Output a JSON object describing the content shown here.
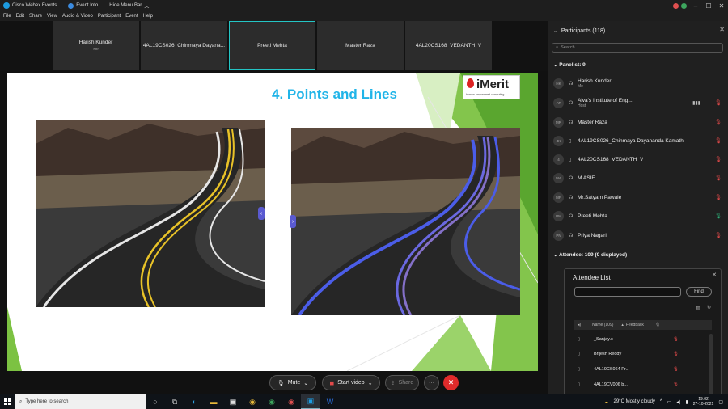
{
  "titlebar": {
    "app_name": "Cisco Webex Events",
    "event_info": "Event Info",
    "hide_menu_bar": "Hide Menu Bar",
    "avatar_colors": [
      "#e05050",
      "#3da55d"
    ]
  },
  "menu": [
    "File",
    "Edit",
    "Share",
    "View",
    "Audio & Video",
    "Participant",
    "Event",
    "Help"
  ],
  "video_tiles": [
    {
      "name": "Harish Kunder",
      "sub": "Me",
      "active": false
    },
    {
      "name": "4AL19CS026_Chinmaya Dayana...",
      "sub": "",
      "active": false
    },
    {
      "name": "Preeti Mehta",
      "sub": "",
      "active": true
    },
    {
      "name": "Master Raza",
      "sub": "",
      "active": false
    },
    {
      "name": "4AL20CS168_VEDANTH_V",
      "sub": "",
      "active": false
    }
  ],
  "slide": {
    "title": "4. Points and Lines",
    "logo_text": "iMerit",
    "logo_tagline": "human-empowered computing",
    "accent_green": "#7cc242",
    "title_color": "#20b4e8"
  },
  "controls": {
    "mute": "Mute",
    "start_video": "Start video",
    "share": "Share",
    "more": "···",
    "end": "✕"
  },
  "participants": {
    "title": "Participants (118)",
    "search_placeholder": "Search",
    "panelist_label": "Panelist: 9",
    "panelists": [
      {
        "initials": "HK",
        "name": "Harish Kunder",
        "sub": "Me",
        "mic": "none"
      },
      {
        "initials": "AT",
        "name": "Alva's Institute of Eng...",
        "sub": "Host",
        "mic": "muted",
        "level": true
      },
      {
        "initials": "MR",
        "name": "Master Raza",
        "sub": "",
        "mic": "muted"
      },
      {
        "initials": "4K",
        "name": "4AL19CS026_Chinmaya Dayananda Kamath",
        "sub": "",
        "mic": "muted",
        "device": true
      },
      {
        "initials": "4",
        "name": "4AL20CS168_VEDANTH_V",
        "sub": "",
        "mic": "muted",
        "device": true
      },
      {
        "initials": "MA",
        "name": "M ASIF",
        "sub": "",
        "mic": "muted"
      },
      {
        "initials": "MP",
        "name": "Mr.Satyam Pawale",
        "sub": "",
        "mic": "muted"
      },
      {
        "initials": "PM",
        "name": "Preeti Mehta",
        "sub": "",
        "mic": "on"
      },
      {
        "initials": "PN",
        "name": "Priya Nagari",
        "sub": "",
        "mic": "muted"
      }
    ],
    "attendee_label": "Attendee: 109 (0 displayed)"
  },
  "attendee_list": {
    "title": "Attendee List",
    "find": "Find",
    "col_name": "Name (109)",
    "col_feedback": "Feedback",
    "rows": [
      "_Sanjay.c",
      "Brijesh Reddy",
      "4AL19CS064  Pr...",
      "4AL19CV006  b..."
    ]
  },
  "taskbar": {
    "search_placeholder": "Type here to search",
    "weather": "29°C  Mostly cloudy",
    "time": "19:02",
    "date": "27-10-2021"
  }
}
